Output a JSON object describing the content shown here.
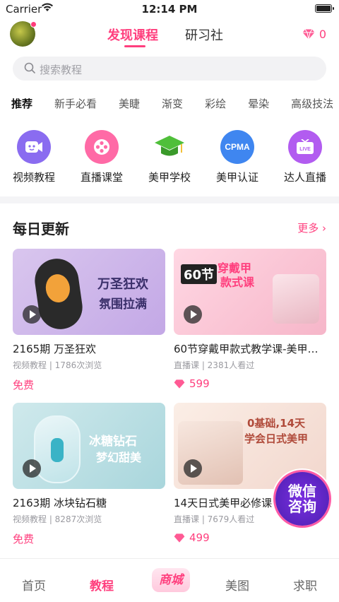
{
  "status_bar": {
    "carrier": "Carrier",
    "time": "12:14 PM"
  },
  "header": {
    "tabs": [
      {
        "label": "发现课程",
        "active": true
      },
      {
        "label": "研习社",
        "active": false
      }
    ],
    "diamond_count": "0"
  },
  "search": {
    "placeholder": "搜索教程"
  },
  "categories": [
    "推荐",
    "新手必看",
    "美睫",
    "渐变",
    "彩绘",
    "晕染",
    "高级技法"
  ],
  "features": [
    {
      "label": "视频教程",
      "icon": "video-tutorial-icon",
      "color": "#8a6cf0"
    },
    {
      "label": "直播课堂",
      "icon": "film-reel-icon",
      "color": "#ff6aa6"
    },
    {
      "label": "美甲学校",
      "icon": "graduation-cap-icon",
      "color": "#4fbf3a"
    },
    {
      "label": "美甲认证",
      "icon": "cpma-badge-icon",
      "color": "#3f86f0"
    },
    {
      "label": "达人直播",
      "icon": "live-tv-icon",
      "color": "#b25cf0"
    }
  ],
  "daily": {
    "title": "每日更新",
    "more": "更多",
    "cards": [
      {
        "title": "2165期 万圣狂欢",
        "meta": "视频教程 | 1786次浏览",
        "price": "免费",
        "thumb_text": [
          "万圣狂欢",
          "氛围拉满"
        ]
      },
      {
        "title": "60节穿戴甲款式教学课-美甲…",
        "meta": "直播课 | 2381人看过",
        "price": "599",
        "thumb_text": [
          "60节",
          "穿戴甲",
          "款式课"
        ]
      },
      {
        "title": "2163期 冰块钻石糖",
        "meta": "视频教程 | 8287次浏览",
        "price": "免费",
        "thumb_text": [
          "冰糖钻石",
          "梦幻甜美"
        ]
      },
      {
        "title": "14天日式美甲必修课",
        "meta": "直播课 | 7679人看过",
        "price": "499",
        "thumb_text": [
          "0基础,14天",
          "学会日式美甲"
        ]
      }
    ]
  },
  "wechat_button": {
    "line1": "微信",
    "line2": "咨询"
  },
  "bottom_nav": [
    {
      "label": "首页",
      "active": false
    },
    {
      "label": "教程",
      "active": true
    },
    {
      "label": "商城",
      "active": false
    },
    {
      "label": "美图",
      "active": false
    },
    {
      "label": "求职",
      "active": false
    }
  ],
  "colors": {
    "accent": "#ff3f7e"
  }
}
